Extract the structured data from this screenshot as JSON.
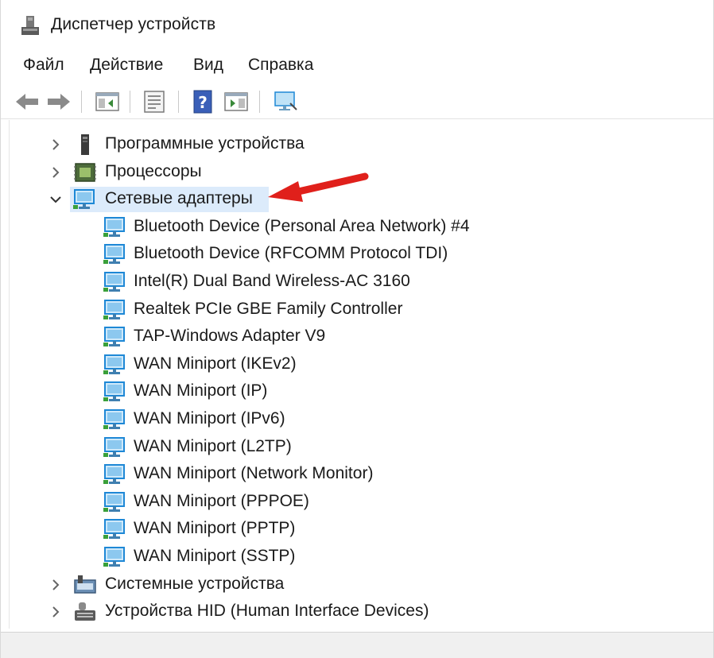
{
  "window": {
    "title": "Диспетчер устройств",
    "app_icon": "device-manager-icon"
  },
  "menu": [
    {
      "label": "Файл"
    },
    {
      "label": "Действие"
    },
    {
      "label": "Вид"
    },
    {
      "label": "Справка"
    }
  ],
  "toolbar": {
    "buttons": [
      {
        "icon": "back-arrow-icon"
      },
      {
        "icon": "forward-arrow-icon"
      },
      {
        "icon": "show-hide-console-tree-icon"
      },
      {
        "icon": "properties-icon"
      },
      {
        "icon": "help-icon"
      },
      {
        "icon": "show-action-pane-icon"
      },
      {
        "icon": "scan-hardware-monitor-icon"
      }
    ]
  },
  "tree": {
    "categories": [
      {
        "label": "Программные устройства",
        "icon": "software-device-icon",
        "expanded": false
      },
      {
        "label": "Процессоры",
        "icon": "processor-icon",
        "expanded": false
      },
      {
        "label": "Сетевые адаптеры",
        "icon": "network-adapter-icon",
        "expanded": true,
        "selected": true
      }
    ],
    "adapters": [
      "Bluetooth Device (Personal Area Network) #4",
      "Bluetooth Device (RFCOMM Protocol TDI)",
      "Intel(R) Dual Band Wireless-AC 3160",
      "Realtek PCIe GBE Family Controller",
      "TAP-Windows Adapter V9",
      "WAN Miniport (IKEv2)",
      "WAN Miniport (IP)",
      "WAN Miniport (IPv6)",
      "WAN Miniport (L2TP)",
      "WAN Miniport (Network Monitor)",
      "WAN Miniport (PPPOE)",
      "WAN Miniport (PPTP)",
      "WAN Miniport (SSTP)"
    ],
    "categories_after": [
      {
        "label": "Системные устройства",
        "icon": "system-devices-icon",
        "expanded": false
      },
      {
        "label": "Устройства HID (Human Interface Devices)",
        "icon": "hid-devices-icon",
        "expanded": false
      }
    ]
  },
  "colors": {
    "selection": "#dcebfb",
    "annotation_arrow": "#e0201b",
    "monitor_blue": "#1e88d6"
  }
}
